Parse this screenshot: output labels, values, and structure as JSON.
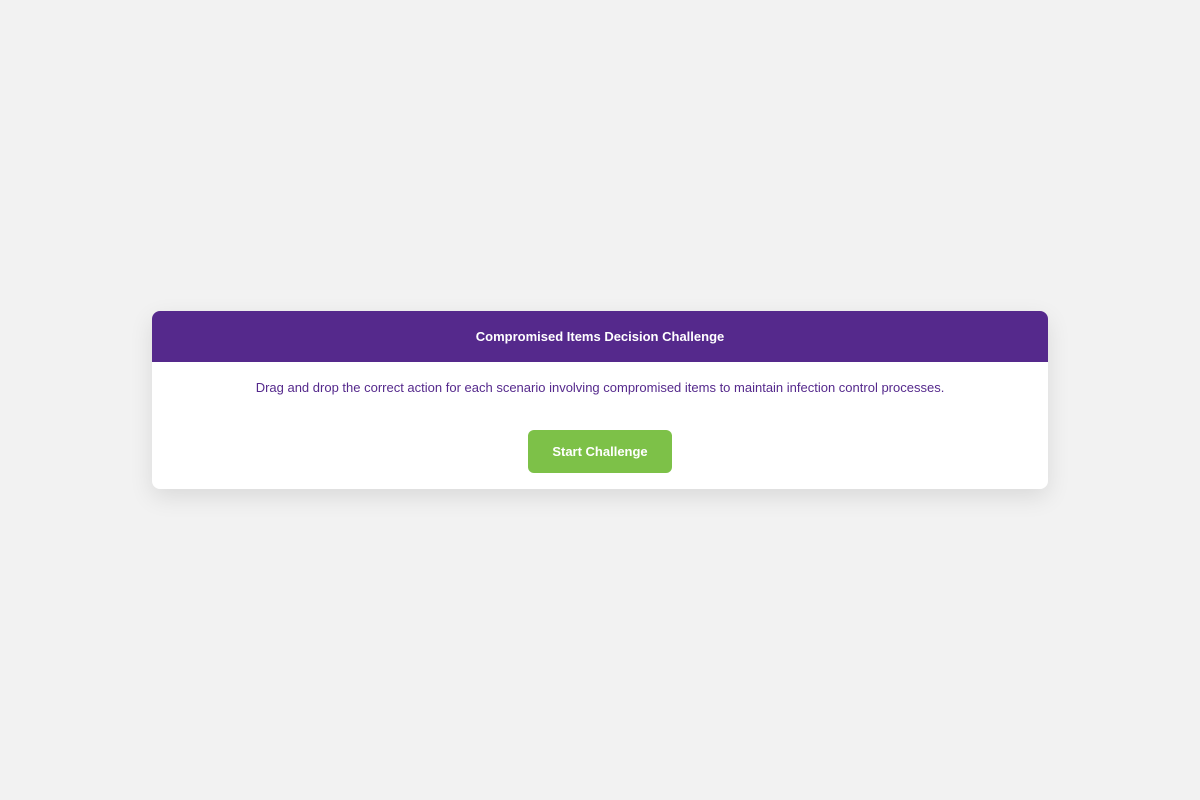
{
  "challenge": {
    "title": "Compromised Items Decision Challenge",
    "instructions": "Drag and drop the correct action for each scenario involving compromised items to maintain infection control processes.",
    "start_label": "Start Challenge"
  },
  "colors": {
    "background": "#f2f2f2",
    "header": "#55298c",
    "instruction_text": "#55298c",
    "button": "#7dc148",
    "button_text": "#ffffff"
  }
}
